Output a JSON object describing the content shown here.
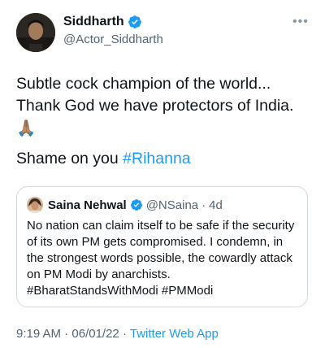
{
  "author": {
    "display_name": "Siddharth",
    "handle": "@Actor_Siddharth"
  },
  "tweet": {
    "line1": "Subtle cock champion of the world... Thank God we have protectors of India.",
    "emoji": "🙏🏽",
    "line2_prefix": "Shame on you ",
    "hashtag": "#Rihanna"
  },
  "quoted_tweet": {
    "display_name": "Saina Nehwal",
    "handle": "@NSaina",
    "separator": "·",
    "age": "4d",
    "text_plain": "No nation can claim itself to be safe if the security of its own PM gets compromised. I condemn, in the strongest words possible, the cowardly attack on PM Modi by anarchists.",
    "hashtags": "#BharatStandsWithModi #PMModi"
  },
  "footer": {
    "time": "9:19 AM",
    "dot1": "·",
    "date": "06/01/22",
    "dot2": "·",
    "source": "Twitter Web App"
  },
  "colors": {
    "link": "#1d9bf0",
    "secondary_text": "#536471",
    "border": "#cfd9de"
  },
  "icons": [
    "verified-badge-icon",
    "more-options-icon"
  ]
}
